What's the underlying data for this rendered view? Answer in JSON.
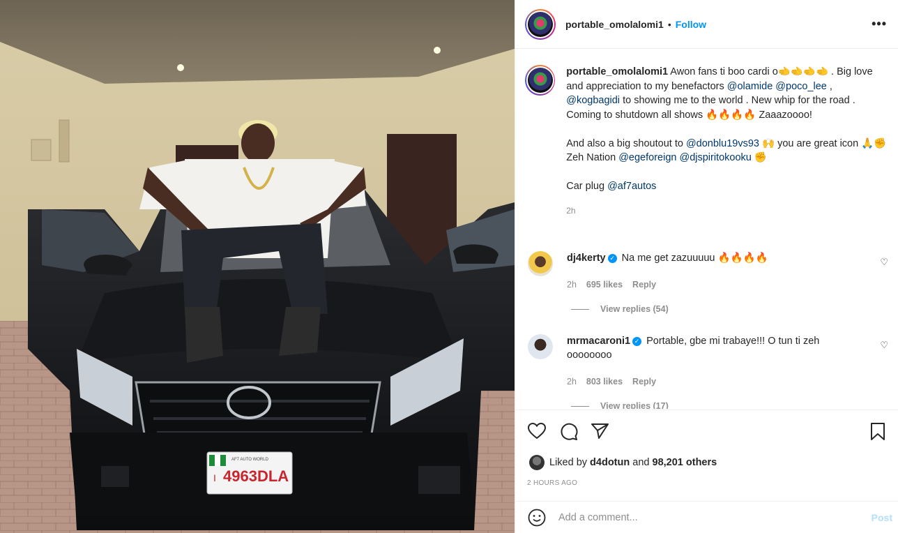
{
  "post": {
    "username": "portable_omolalomi1",
    "separator": "•",
    "follow_label": "Follow",
    "more_label": "•••"
  },
  "caption": {
    "username": "portable_omolalomi1",
    "p1_a": " Awon fans ti boo cardi o🫲🫲🫲🫲 . Big love and appreciation to my benefactors ",
    "m1": "@olamide",
    "p1_b": " ",
    "m2": "@poco_lee",
    "p1_c": " , ",
    "m3": "@kogbagidi",
    "p1_d": " to showing me to the world . New whip for the road . Coming to shutdown all shows 🔥🔥🔥🔥 Zaaazoooo!",
    "p2_a": "And also a big shoutout to ",
    "m4": "@donblu19vs93",
    "p2_b": " 🙌 you are great icon 🙏✊",
    "p3_a": "Zeh Nation ",
    "m5": "@egeforeign",
    "p3_b": " ",
    "m6": "@djspiritokooku",
    "p3_c": " ✊",
    "p4_a": "Car plug ",
    "m7": "@af7autos",
    "time": "2h"
  },
  "comments": [
    {
      "username": "dj4kerty",
      "verified": "✓",
      "text": "Na me get zazuuuuu 🔥🔥🔥🔥",
      "time": "2h",
      "likes": "695 likes",
      "reply_label": "Reply",
      "view_replies": "View replies (54)"
    },
    {
      "username": "mrmacaroni1",
      "verified": "✓",
      "text": "Portable, gbe mi trabaye!!! O tun ti zeh oooooooo",
      "time": "2h",
      "likes": "803 likes",
      "reply_label": "Reply",
      "view_replies": "View replies (17)"
    }
  ],
  "likes": {
    "prefix": "Liked by ",
    "user": "d4dotun",
    "middle": " and ",
    "count": "98,201 others"
  },
  "timestamp": "2 HOURS AGO",
  "add_comment": {
    "placeholder": "Add a comment...",
    "post_label": "Post",
    "emoji_icon": "smiley-icon"
  },
  "plate": {
    "number": "4963DLA",
    "prefix": "I",
    "dealer": "AF7 AUTO WORLD"
  },
  "icons": [
    "heart-icon",
    "comment-icon",
    "share-icon",
    "bookmark-icon",
    "more-icon"
  ],
  "colors": {
    "link_blue": "#0095f6",
    "mention_blue": "#00376b",
    "muted": "#8e8e8e"
  }
}
